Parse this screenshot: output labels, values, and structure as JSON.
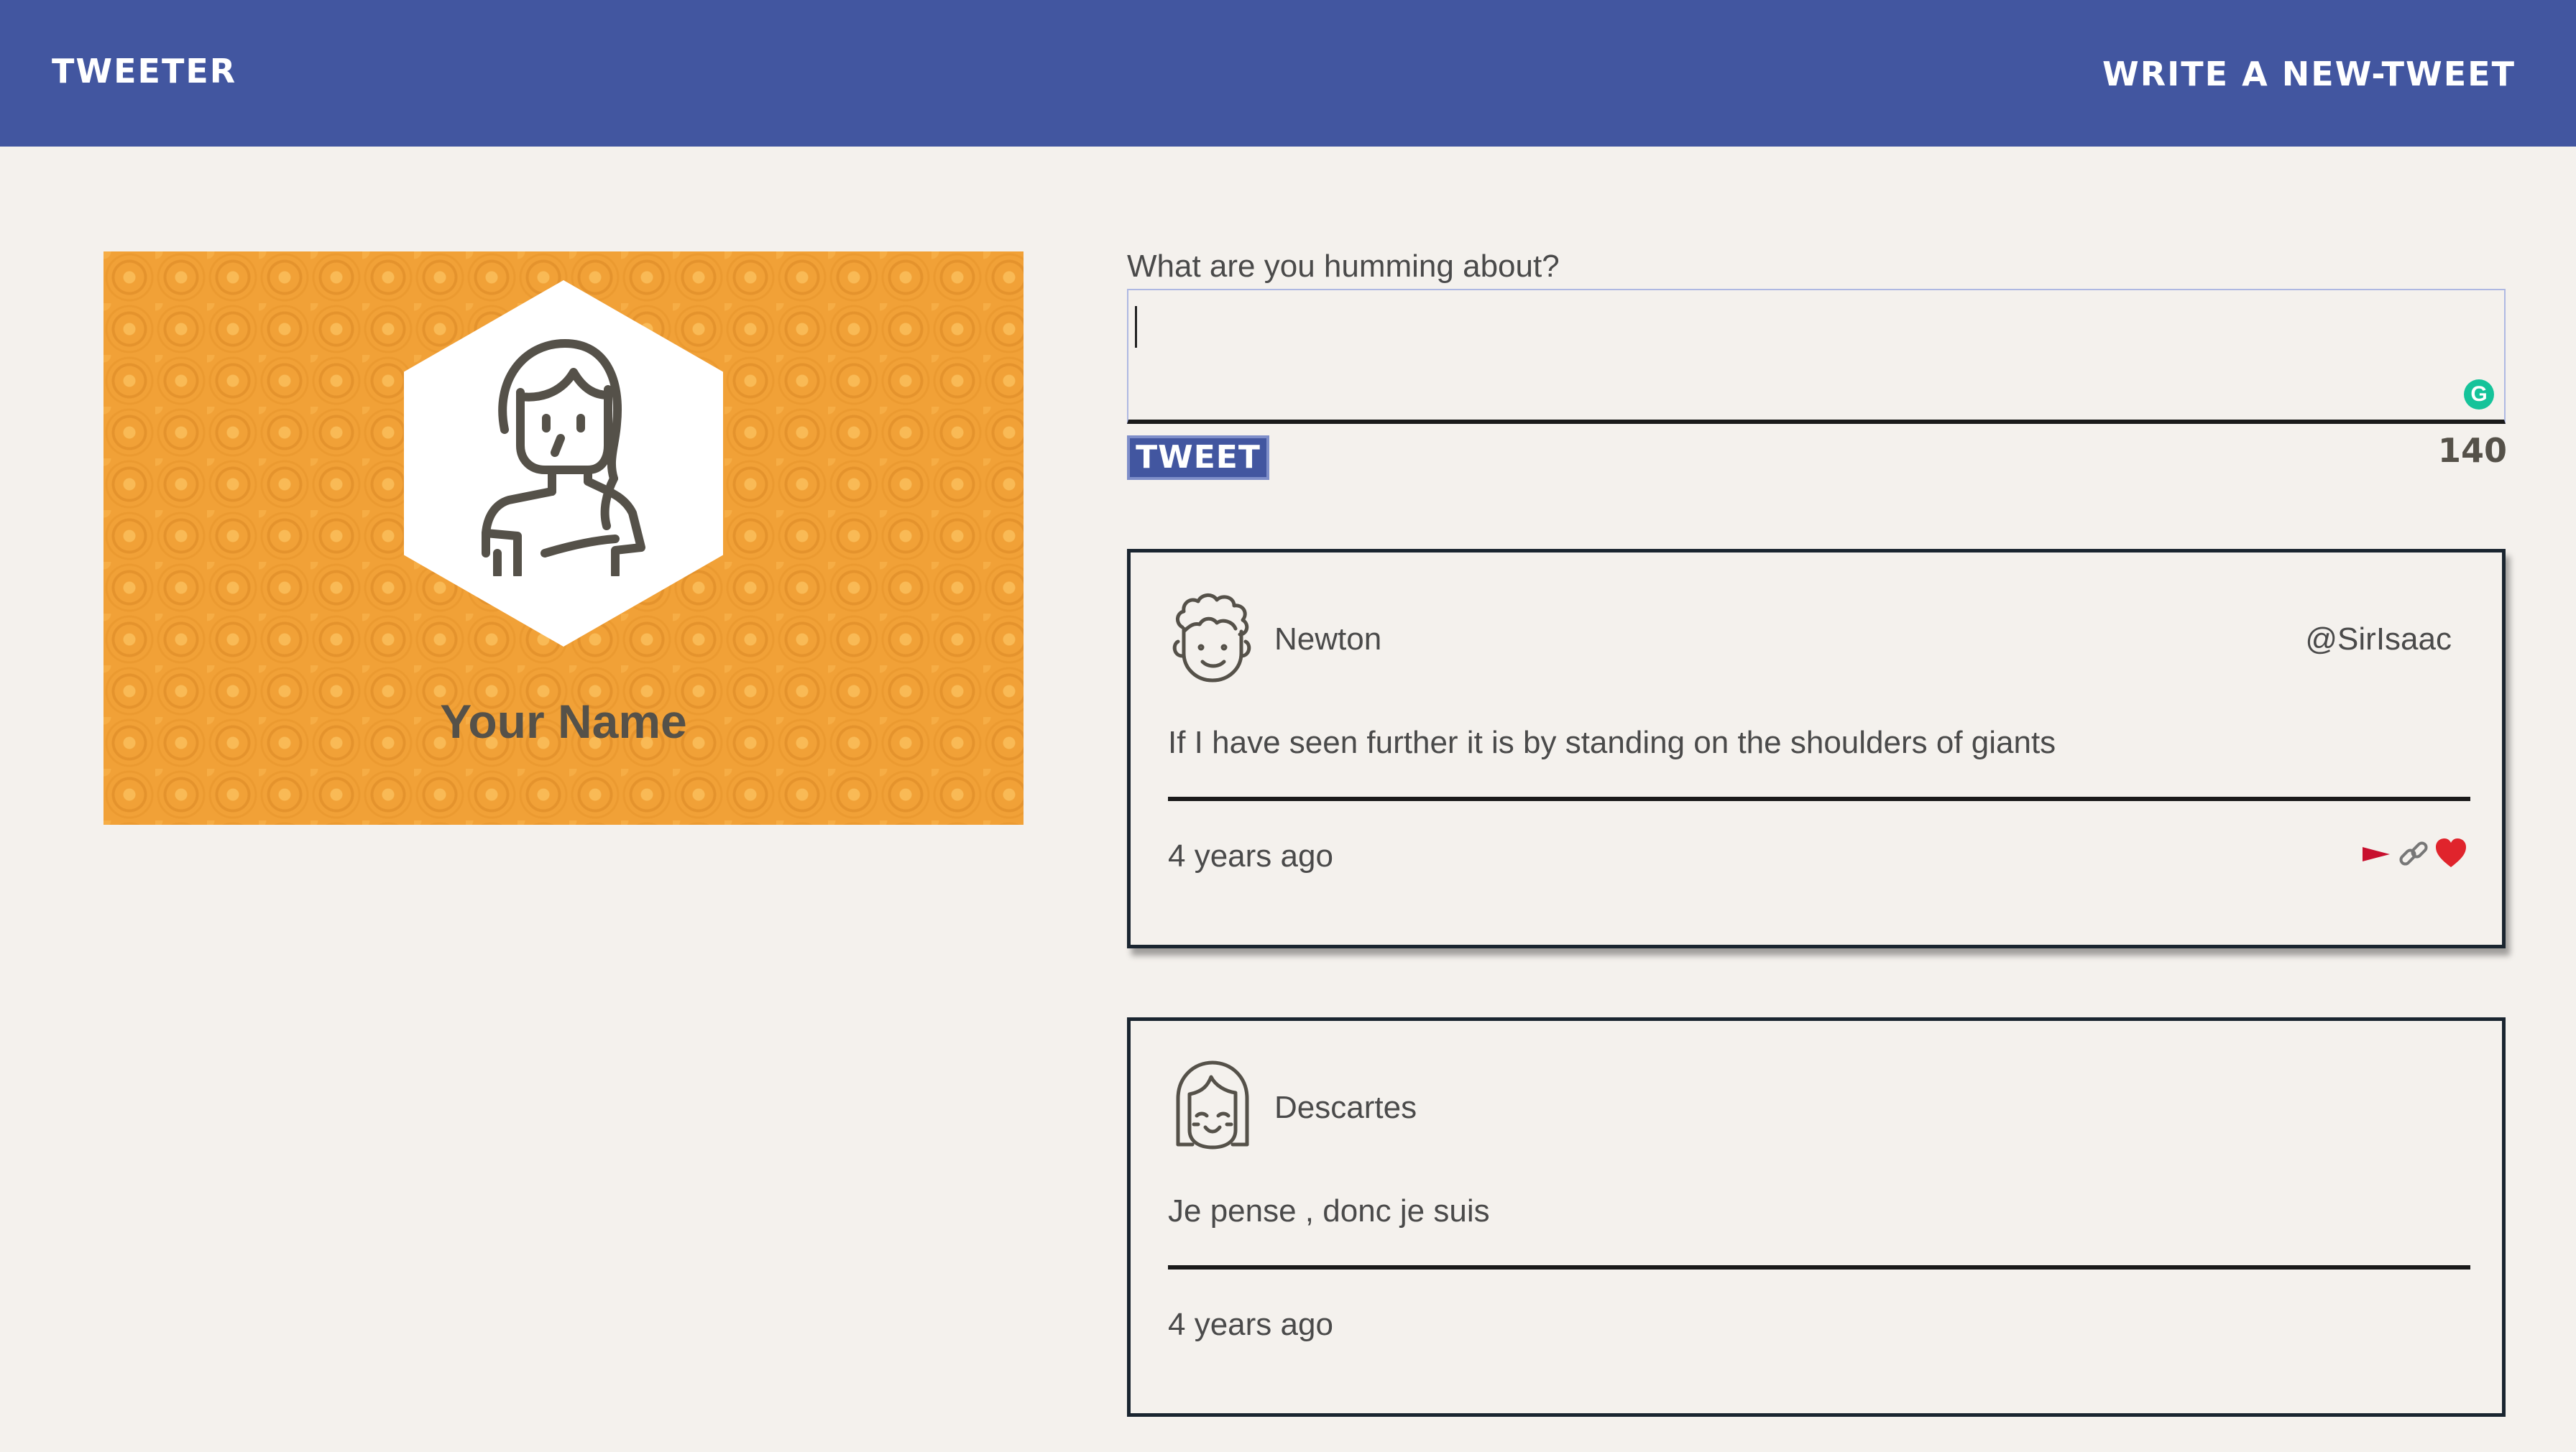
{
  "nav": {
    "brand": "TWEETER",
    "compose_link": "WRITE A NEW-TWEET"
  },
  "profile": {
    "name": "Your Name",
    "avatar_icon": "woman-avatar-icon"
  },
  "compose": {
    "label": "What are you humming about?",
    "value": "",
    "button_label": "TWEET",
    "counter": "140",
    "grammarly_icon": "G"
  },
  "tweets": [
    {
      "name": "Newton",
      "handle": "@SirIsaac",
      "text": "If I have seen further it is by standing on the shoulders of giants",
      "time": "4 years ago",
      "avatar_icon": "curly-hair-face-icon",
      "actions": [
        "flag-icon",
        "retweet-link-icon",
        "heart-icon"
      ]
    },
    {
      "name": "Descartes",
      "handle": "",
      "text": "Je pense , donc je suis",
      "time": "4 years ago",
      "avatar_icon": "bob-hair-face-icon"
    }
  ],
  "colors": {
    "nav_bg": "#4256a0",
    "page_bg": "#f4f1ed",
    "profile_bg": "#f1a137",
    "flag": "#c8102e",
    "heart": "#e0242c"
  }
}
